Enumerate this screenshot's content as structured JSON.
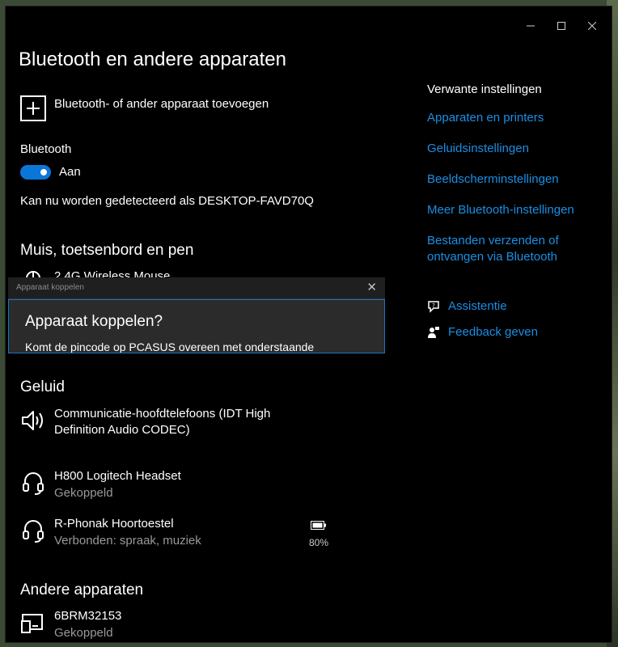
{
  "window": {
    "title": "Bluetooth en andere apparaten",
    "controls": [
      "minimize-icon",
      "maximize-icon",
      "close-icon"
    ]
  },
  "add_device": {
    "label": "Bluetooth- of ander apparaat toevoegen",
    "icon": "plus-icon"
  },
  "bluetooth": {
    "label": "Bluetooth",
    "toggle_state": "Aan",
    "toggle_on": true,
    "discoverable": "Kan nu worden gedetecteerd als DESKTOP-FAVD70Q"
  },
  "sections": {
    "mouse": {
      "heading": "Muis, toetsenbord en pen",
      "devices": [
        {
          "name": "2.4G Wireless Mouse",
          "icon": "mouse-icon"
        }
      ]
    },
    "audio": {
      "heading": "Geluid",
      "devices": [
        {
          "name_line1": "Communicatie-hoofdtelefoons (IDT High",
          "name_line2": "Definition Audio CODEC)",
          "icon": "speaker-icon"
        },
        {
          "name": "H800 Logitech Headset",
          "status": "Gekoppeld",
          "icon": "headset-icon"
        },
        {
          "name": "R-Phonak Hoortoestel",
          "status": "Verbonden: spraak, muziek",
          "icon": "headset-icon",
          "battery": "80%"
        }
      ]
    },
    "other": {
      "heading": "Andere apparaten",
      "devices": [
        {
          "name": "6BRM32153",
          "status": "Gekoppeld",
          "icon": "device-icon"
        }
      ]
    }
  },
  "related": {
    "heading": "Verwante instellingen",
    "links": [
      "Apparaten en printers",
      "Geluidsinstellingen",
      "Beeldscherminstellingen",
      "Meer Bluetooth-instellingen",
      "Bestanden verzenden of",
      "ontvangen via Bluetooth"
    ],
    "help": [
      {
        "label": "Assistentie",
        "icon": "help-chat-icon"
      },
      {
        "label": "Feedback geven",
        "icon": "feedback-icon"
      }
    ]
  },
  "dialog": {
    "title": "Apparaat koppelen",
    "heading": "Apparaat koppelen?",
    "text": "Komt de pincode op PCASUS overeen met onderstaande"
  },
  "colors": {
    "accent": "#1a8fe3",
    "toggle": "#0a76d8",
    "background": "#000000",
    "secondary_text": "#999999"
  }
}
